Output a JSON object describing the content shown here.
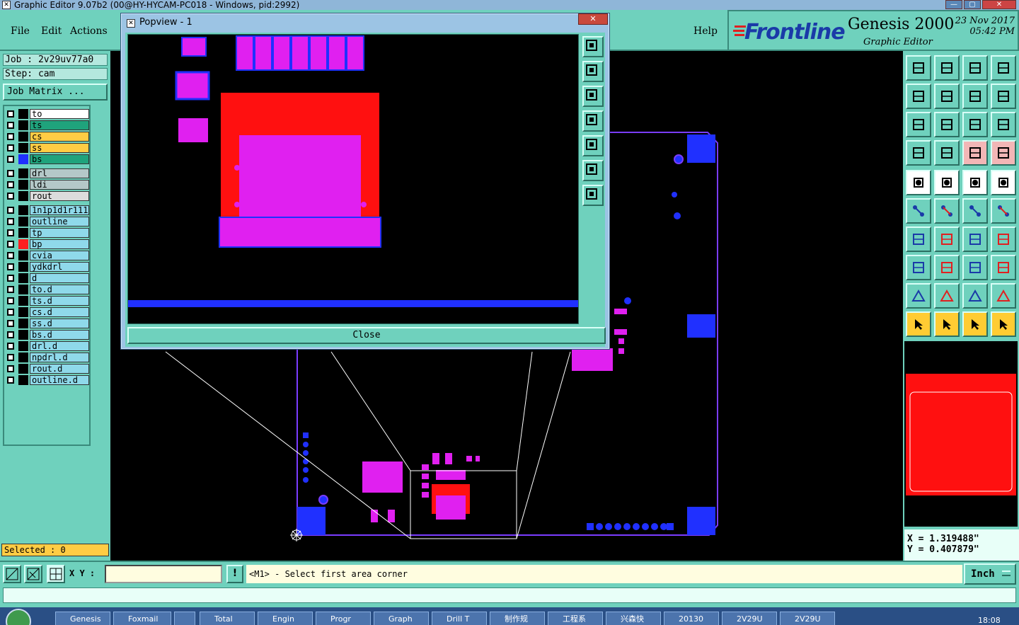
{
  "window": {
    "title": "Graphic Editor 9.07b2 (00@HY-HYCAM-PC018 - Windows, pid:2992)"
  },
  "menu": {
    "file": "File",
    "edit": "Edit",
    "actions": "Actions",
    "help": "Help"
  },
  "brand": {
    "logo": "Frontline",
    "product": "Genesis 2000",
    "subtitle": "Graphic Editor",
    "date": "23 Nov 2017",
    "time": "05:42 PM"
  },
  "job": {
    "job_line": "Job : 2v29uv77a0",
    "step_line": "Step: cam",
    "matrix_button": "Job Matrix ..."
  },
  "layers": [
    {
      "name": "to",
      "color": "#ffffff",
      "swatch": "#000000"
    },
    {
      "name": "ts",
      "color": "#1fa37c",
      "swatch": "#000000"
    },
    {
      "name": "cs",
      "color": "#ffcc44",
      "swatch": "#000000"
    },
    {
      "name": "ss",
      "color": "#ffcc44",
      "swatch": "#000000"
    },
    {
      "name": "bs",
      "color": "#1fa37c",
      "swatch": "#2030ff"
    },
    {
      "name": "drl",
      "color": "#b4c8c8",
      "swatch": "#000000"
    },
    {
      "name": "ldi",
      "color": "#b4c8c8",
      "swatch": "#000000"
    },
    {
      "name": "rout",
      "color": "#dcdcdc",
      "swatch": "#000000"
    },
    {
      "name": "1n1p1d1r111",
      "color": "#8fd9ea",
      "swatch": "#000000"
    },
    {
      "name": "outline",
      "color": "#8fd9ea",
      "swatch": "#000000"
    },
    {
      "name": "tp",
      "color": "#8fd9ea",
      "swatch": "#000000"
    },
    {
      "name": "bp",
      "color": "#8fd9ea",
      "swatch": "#ff2020"
    },
    {
      "name": "cvia",
      "color": "#8fd9ea",
      "swatch": "#000000"
    },
    {
      "name": "ydkdrl",
      "color": "#8fd9ea",
      "swatch": "#000000"
    },
    {
      "name": "d",
      "color": "#8fd9ea",
      "swatch": "#000000"
    },
    {
      "name": "to.d",
      "color": "#8fd9ea",
      "swatch": "#000000"
    },
    {
      "name": "ts.d",
      "color": "#8fd9ea",
      "swatch": "#000000"
    },
    {
      "name": "cs.d",
      "color": "#8fd9ea",
      "swatch": "#000000"
    },
    {
      "name": "ss.d",
      "color": "#8fd9ea",
      "swatch": "#000000"
    },
    {
      "name": "bs.d",
      "color": "#8fd9ea",
      "swatch": "#000000"
    },
    {
      "name": "drl.d",
      "color": "#8fd9ea",
      "swatch": "#000000"
    },
    {
      "name": "npdrl.d",
      "color": "#8fd9ea",
      "swatch": "#000000"
    },
    {
      "name": "rout.d",
      "color": "#8fd9ea",
      "swatch": "#000000"
    },
    {
      "name": "outline.d",
      "color": "#8fd9ea",
      "swatch": "#000000"
    }
  ],
  "selected": "Selected : 0",
  "coords": {
    "x": "X = 1.319488\"",
    "y": "Y = 0.407879\""
  },
  "command": {
    "xy_label": "X Y :",
    "xy_value": "",
    "prompt": "<M1> - Select first area corner",
    "unit": "Inch"
  },
  "popup": {
    "title": "Popview - 1",
    "close_label": "Close"
  },
  "taskbar": {
    "items": [
      "Genesis",
      "Foxmail",
      "",
      "Total",
      "Engin",
      "Progr",
      "Graph",
      "Drill T",
      "制作规",
      "工程系",
      "兴森快",
      "20130",
      "2V29U",
      "2V29U"
    ],
    "time": "18:08"
  },
  "colors": {
    "panel": "#6fd1bd",
    "pad_magenta": "#e020f0",
    "copper_blue": "#2030ff",
    "solder_red": "#ff1010"
  }
}
